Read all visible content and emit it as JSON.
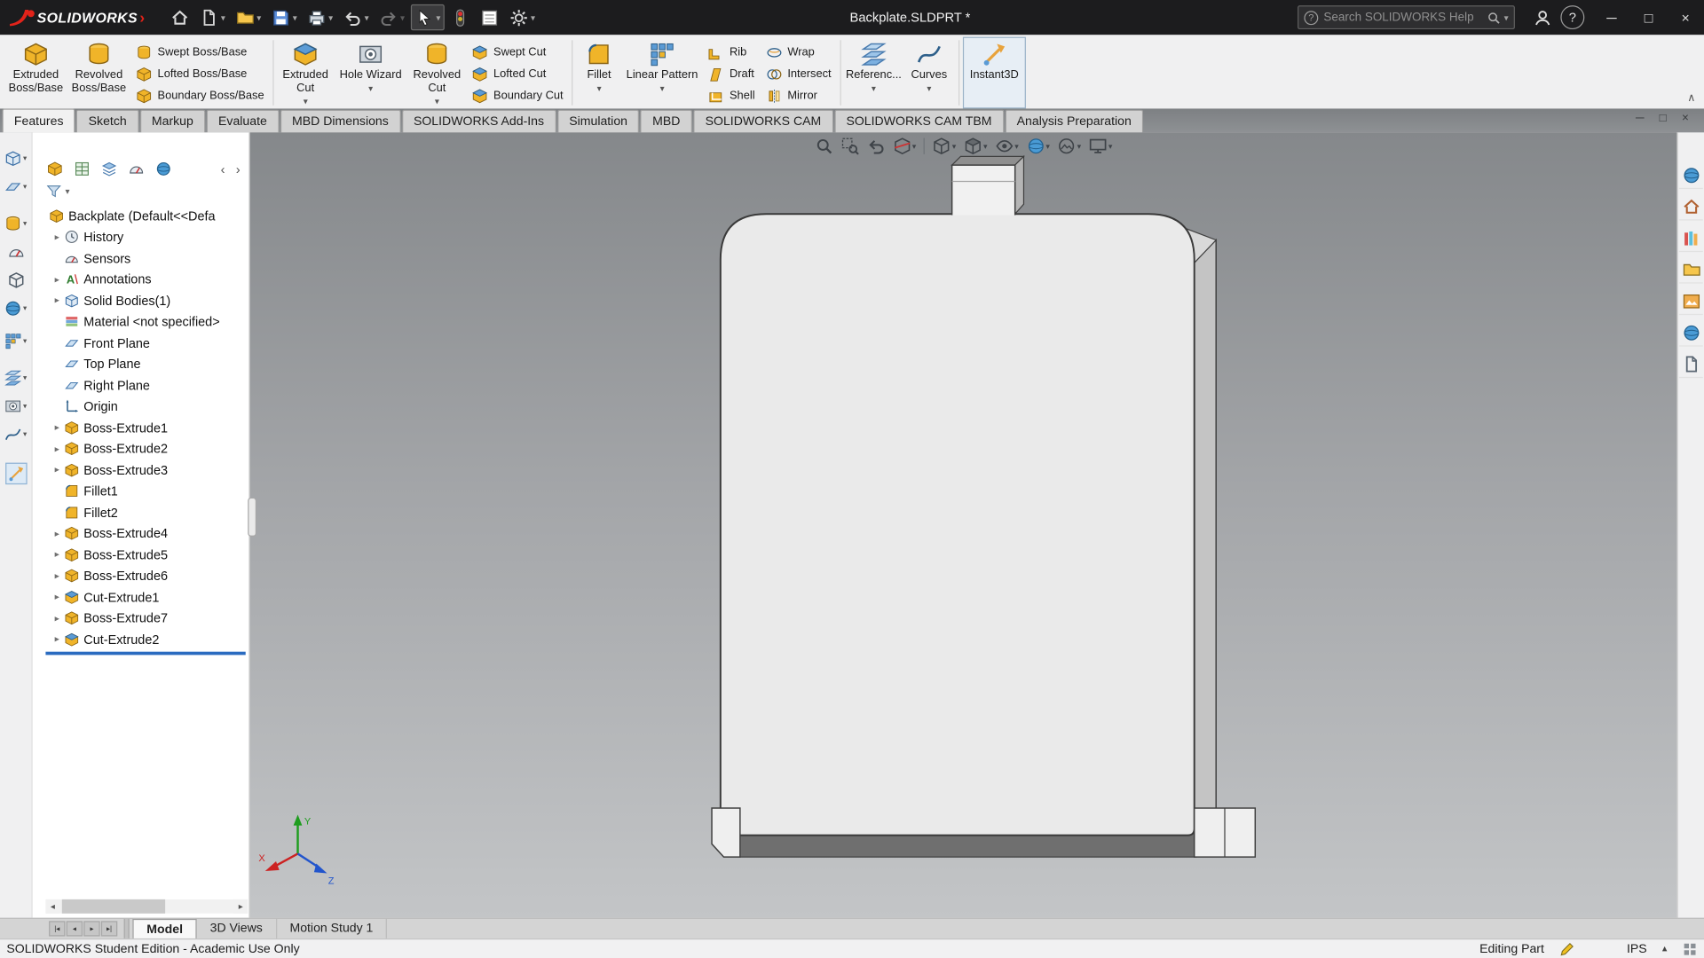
{
  "titlebar": {
    "logo_text": "SOLIDWORKS",
    "title": "Backplate.SLDPRT *",
    "search_placeholder": "Search SOLIDWORKS Help"
  },
  "ribbon": {
    "extruded_boss": "Extruded Boss/Base",
    "revolved_boss": "Revolved Boss/Base",
    "swept_boss": "Swept Boss/Base",
    "lofted_boss": "Lofted Boss/Base",
    "boundary_boss": "Boundary Boss/Base",
    "extruded_cut": "Extruded Cut",
    "hole_wizard": "Hole Wizard",
    "revolved_cut": "Revolved Cut",
    "swept_cut": "Swept Cut",
    "lofted_cut": "Lofted Cut",
    "boundary_cut": "Boundary Cut",
    "fillet": "Fillet",
    "linear_pattern": "Linear Pattern",
    "rib": "Rib",
    "draft": "Draft",
    "shell": "Shell",
    "wrap": "Wrap",
    "intersect": "Intersect",
    "mirror": "Mirror",
    "reference_geometry": "Referenc...",
    "curves": "Curves",
    "instant3d": "Instant3D"
  },
  "tabs": [
    "Features",
    "Sketch",
    "Markup",
    "Evaluate",
    "MBD Dimensions",
    "SOLIDWORKS Add-Ins",
    "Simulation",
    "MBD",
    "SOLIDWORKS CAM",
    "SOLIDWORKS CAM TBM",
    "Analysis Preparation"
  ],
  "tree": {
    "root": "Backplate (Default<<Defa",
    "items": [
      "History",
      "Sensors",
      "Annotations",
      "Solid Bodies(1)",
      "Material <not specified>",
      "Front Plane",
      "Top Plane",
      "Right Plane",
      "Origin",
      "Boss-Extrude1",
      "Boss-Extrude2",
      "Boss-Extrude3",
      "Fillet1",
      "Fillet2",
      "Boss-Extrude4",
      "Boss-Extrude5",
      "Boss-Extrude6",
      "Cut-Extrude1",
      "Boss-Extrude7",
      "Cut-Extrude2"
    ]
  },
  "doc_tabs": {
    "model": "Model",
    "views_3d": "3D Views",
    "motion": "Motion Study 1"
  },
  "statusbar": {
    "edition": "SOLIDWORKS Student Edition - Academic Use Only",
    "mode": "Editing Part",
    "units": "IPS"
  },
  "icons": {
    "caret_down": "▾",
    "caret_up": "▴",
    "collapse_ribbon": "∧",
    "chevron_left": "‹",
    "chevron_right": "›",
    "tree_expand": "▸",
    "scroll_left": "◂",
    "scroll_right": "▸",
    "nav_first": "|◂",
    "nav_prev": "◂",
    "nav_next": "▸",
    "nav_last": "▸|",
    "minimize": "─",
    "maximize": "□",
    "close": "×",
    "help": "?"
  },
  "colors": {
    "brand_red": "#e2231a",
    "accent_blue": "#2a6bc0",
    "feature_gold": "#f0b429"
  }
}
